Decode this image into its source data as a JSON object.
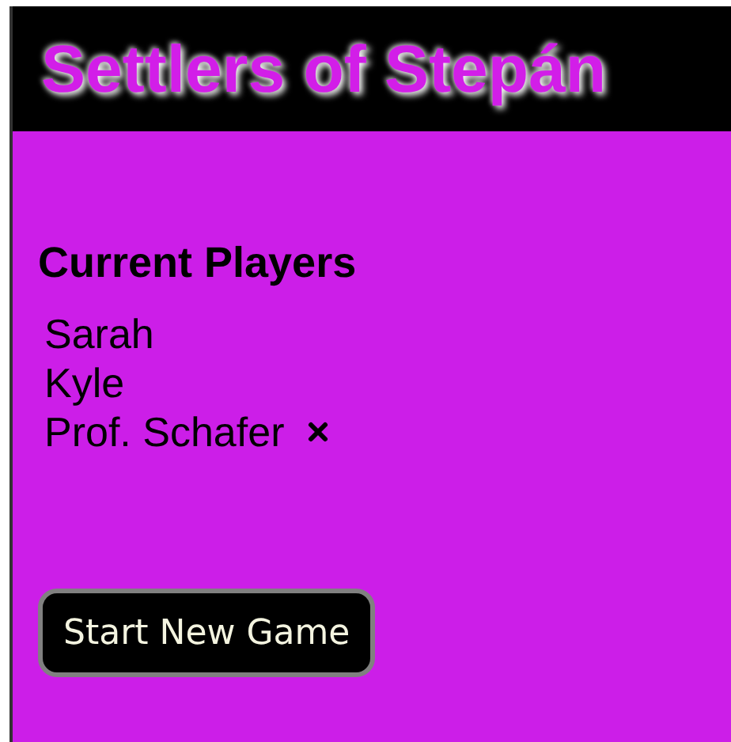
{
  "header": {
    "title": "Settlers of Stepán"
  },
  "players_section": {
    "heading": "Current Players",
    "players": [
      {
        "name": "Sarah",
        "removable": false
      },
      {
        "name": "Kyle",
        "removable": false
      },
      {
        "name": "Prof. Schafer",
        "removable": true
      }
    ]
  },
  "buttons": [
    "Start New Game"
  ]
}
